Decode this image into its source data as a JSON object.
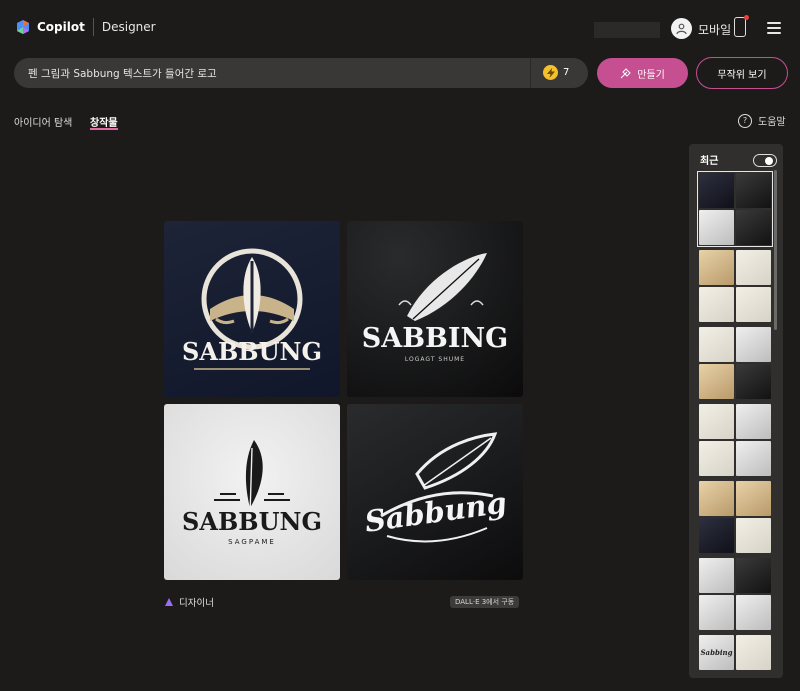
{
  "header": {
    "brand": "Copilot",
    "product": "Designer",
    "mobile_label": "모바일"
  },
  "prompt": {
    "value": "펜 그림과 Sabbung 텍스트가 들어간 로고",
    "boost_count": "7",
    "create_label": "만들기",
    "random_label": "무작위 보기"
  },
  "tabs": [
    {
      "label": "아이디어 탐색",
      "active": false
    },
    {
      "label": "창작물",
      "active": true
    }
  ],
  "help_label": "도움말",
  "images": [
    {
      "text": "SABBUNG"
    },
    {
      "text": "SABBING",
      "subtext": "LOGAGT SHUME"
    },
    {
      "text": "SABBUNG",
      "subtext": "SAGPAME"
    },
    {
      "text": "Sabbung"
    }
  ],
  "footer": {
    "designer_label": "디자이너",
    "dalle_badge": "DALL·E 3에서 구동"
  },
  "sidebar": {
    "title": "최근",
    "thumb_texts": [
      "Sabbing"
    ]
  },
  "colors": {
    "accent": "#c64f91",
    "background": "#1d1b1a",
    "boost": "#f3c12d"
  }
}
